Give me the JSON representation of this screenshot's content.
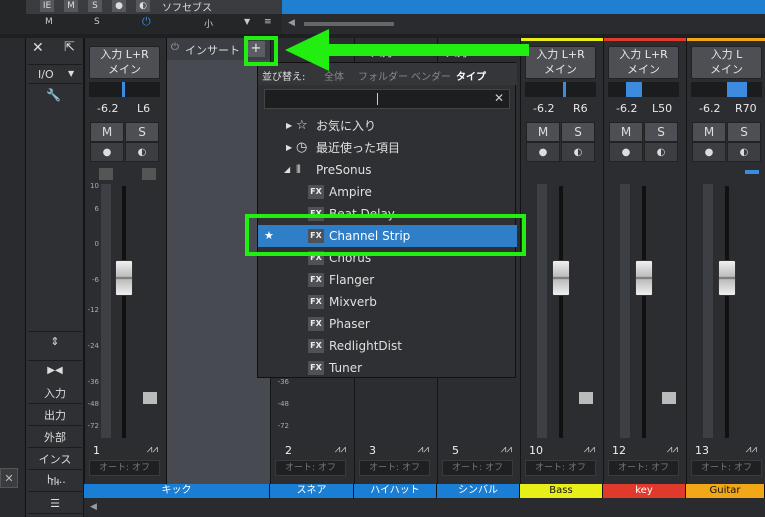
{
  "top": {
    "buttons": [
      "IE",
      "M",
      "S"
    ],
    "app_label": "ソフセブス",
    "ms_m": "M",
    "ms_s": "S",
    "small_label": "小"
  },
  "side": {
    "io_label": "I/O",
    "buttons": [
      "入力",
      "出力",
      "外部",
      "インスト..."
    ]
  },
  "channels": [
    {
      "input": "入力 L+R",
      "sub": "メイン",
      "vol": "-6.2",
      "pan": "L6",
      "num": "1",
      "name": "キック",
      "name_bg": "#1a7fd4",
      "name_fg": "#ffffff",
      "top": "#2c2d31"
    },
    {
      "input": "入力 L+R",
      "sub": "メイン",
      "vol": "-6.2",
      "pan": "R6",
      "num": "10",
      "name": "Bass",
      "name_bg": "#e8ee18",
      "name_fg": "#111111",
      "top": "#e8ee18"
    },
    {
      "input": "入力 L+R",
      "sub": "メイン",
      "vol": "-6.2",
      "pan": "L50",
      "num": "12",
      "name": "key",
      "name_bg": "#e03a2c",
      "name_fg": "#ffffff",
      "top": "#e03a2c"
    },
    {
      "input": "入力 L",
      "sub": "メイン",
      "vol": "-6.2",
      "pan": "R70",
      "num": "13",
      "name": "Guitar",
      "name_bg": "#f0a818",
      "name_fg": "#111111",
      "top": "#f0a818"
    }
  ],
  "hidden_channels": [
    {
      "num": "2",
      "name": "スネア"
    },
    {
      "num": "3",
      "name": "ハイハット"
    },
    {
      "num": "5",
      "name": "シンバル"
    }
  ],
  "common": {
    "mute": "M",
    "solo": "S",
    "auto": "オート: オフ",
    "auto_short": "オート: オフ",
    "scale": [
      "10",
      "6",
      "0",
      "-6",
      "-12",
      "-24",
      "-36",
      "-48",
      "-72"
    ]
  },
  "insert": {
    "label": "インサート",
    "plus": "+"
  },
  "browser": {
    "sort_label": "並び替え:",
    "sort_options": [
      "全体",
      "フォルダー",
      "ベンダー",
      "タイプ"
    ],
    "sort_active": "タイプ",
    "search_value": "",
    "favorites": "お気に入り",
    "recent": "最近使った項目",
    "vendor": "PreSonus",
    "plugins": [
      "Ampire",
      "Beat Delay",
      "Channel Strip",
      "Chorus",
      "Flanger",
      "Mixverb",
      "Phaser",
      "RedlightDist",
      "Tuner"
    ],
    "selected": "Channel Strip",
    "fx_badge": "FX",
    "star": "★"
  },
  "behind_header": [
    "入力 L+R",
    "入力 L+R"
  ]
}
